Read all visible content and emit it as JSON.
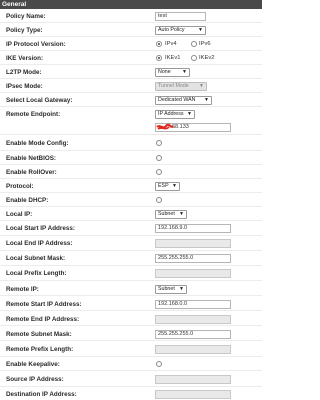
{
  "section_title": "General",
  "fields": {
    "policy_name": {
      "label": "Policy Name:",
      "value": "test"
    },
    "policy_type": {
      "label": "Policy Type:",
      "value": "Auto Policy"
    },
    "ip_protocol_version": {
      "label": "IP Protocol Version:",
      "options": [
        "IPv4",
        "IPv6"
      ],
      "selected": "IPv4"
    },
    "ike_version": {
      "label": "IKE Version:",
      "options": [
        "IKEv1",
        "IKEv2"
      ],
      "selected": "IKEv1"
    },
    "l2tp_mode": {
      "label": "L2TP Mode:",
      "value": "None"
    },
    "ipsec_mode": {
      "label": "IPsec Mode:",
      "value": "Tunnel Mode"
    },
    "local_gateway": {
      "label": "Select Local Gateway:",
      "value": "Dedicated WAN"
    },
    "remote_endpoint": {
      "label": "Remote Endpoint:",
      "value": "IP Address",
      "address_visible": "68.133"
    },
    "mode_config": {
      "label": "Enable Mode Config:"
    },
    "netbios": {
      "label": "Enable NetBIOS:"
    },
    "rollover": {
      "label": "Enable RollOver:"
    },
    "protocol": {
      "label": "Protocol:",
      "value": "ESP"
    },
    "dhcp": {
      "label": "Enable DHCP:"
    },
    "local_ip": {
      "label": "Local IP:",
      "value": "Subnet"
    },
    "local_start_ip": {
      "label": "Local Start IP Address:",
      "value": "192.168.9.0"
    },
    "local_end_ip": {
      "label": "Local End IP Address:",
      "value": ""
    },
    "local_subnet_mask": {
      "label": "Local Subnet Mask:",
      "value": "255.255.255.0"
    },
    "local_prefix_length": {
      "label": "Local Prefix Length:",
      "value": ""
    },
    "remote_ip": {
      "label": "Remote IP:",
      "value": "Subnet"
    },
    "remote_start_ip": {
      "label": "Remote Start IP Address:",
      "value": "192.168.0.0"
    },
    "remote_end_ip": {
      "label": "Remote End IP Address:",
      "value": ""
    },
    "remote_subnet_mask": {
      "label": "Remote Subnet Mask:",
      "value": "255.255.255.0"
    },
    "remote_prefix_length": {
      "label": "Remote Prefix Length:",
      "value": ""
    },
    "keepalive": {
      "label": "Enable Keepalive:"
    },
    "source_ip": {
      "label": "Source IP Address:",
      "value": ""
    },
    "destination_ip": {
      "label": "Destination IP Address:",
      "value": ""
    }
  },
  "colors": {
    "header_bg": "#4a4a4a",
    "redaction": "#e0281e"
  }
}
